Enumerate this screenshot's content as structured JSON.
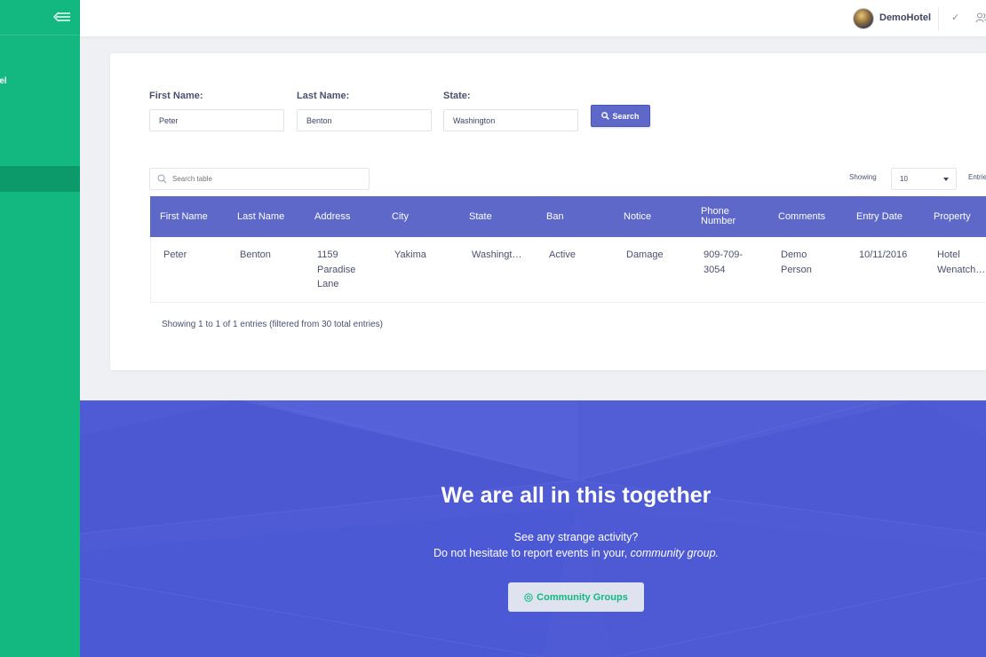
{
  "sidebar": {
    "brand_fragment": "tel"
  },
  "topbar": {
    "user_name": "DemoHotel"
  },
  "search_form": {
    "first_name_label": "First Name:",
    "first_name_value": "Peter",
    "last_name_label": "Last Name:",
    "last_name_value": "Benton",
    "state_label": "State:",
    "state_value": "Washington",
    "search_button": "Search"
  },
  "table_controls": {
    "search_placeholder": "Search table",
    "showing_label": "Showing",
    "page_size": "10",
    "entries_label": "Entries"
  },
  "table": {
    "headers": [
      "First Name",
      "Last Name",
      "Address",
      "City",
      "State",
      "Ban",
      "Notice",
      "Phone Number",
      "Comments",
      "Entry Date",
      "Property"
    ],
    "rows": [
      {
        "first_name": "Peter",
        "last_name": "Benton",
        "address": "1159 Paradise Lane",
        "city": "Yakima",
        "state": "Washingt…",
        "ban": "Active",
        "notice": "Damage",
        "phone": "909-709-3054",
        "comments": "Demo Person",
        "entry_date": "10/11/2016",
        "property": "Hotel Wenatch…"
      }
    ],
    "info": "Showing 1 to 1 of 1 entries (filtered from 30 total entries)"
  },
  "banner": {
    "title": "We are all in this together",
    "line1": "See any strange activity?",
    "line2_prefix": "Do not hesitate to report events in your,",
    "line2_emphasis": "community group.",
    "button": "Community Groups"
  },
  "colors": {
    "sidebar": "#12b87f",
    "accent": "#5d68c9",
    "banner": "#4f5bd5"
  },
  "icons": [
    "menu-collapse-icon",
    "check-icon",
    "users-icon",
    "search-icon",
    "chevron-down-icon",
    "community-icon"
  ]
}
